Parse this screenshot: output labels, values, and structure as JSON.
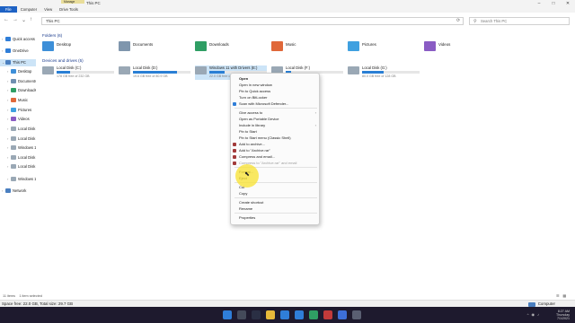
{
  "window": {
    "title": "This PC",
    "manage_tab": "Manage",
    "ribbon_tabs": [
      "File",
      "Computer",
      "View",
      "Drive Tools"
    ],
    "controls": [
      "–",
      "□",
      "✕"
    ]
  },
  "address": {
    "path": "This PC",
    "search_placeholder": "Search This PC"
  },
  "nav": {
    "items": [
      {
        "label": "Quick access",
        "color": "#2f7ed8",
        "chev": "›"
      },
      {
        "label": "OneDrive",
        "color": "#2f7ed8",
        "chev": "›"
      },
      {
        "label": "This PC",
        "color": "#4a7fc0",
        "chev": "⌄"
      },
      {
        "label": "Desktop",
        "color": "#3d8fd8",
        "chev": "›"
      },
      {
        "label": "Documents",
        "color": "#6f8fb0",
        "chev": "›"
      },
      {
        "label": "Downloads",
        "color": "#2f9e64",
        "chev": "›"
      },
      {
        "label": "Music",
        "color": "#e0683a",
        "chev": "›"
      },
      {
        "label": "Pictures",
        "color": "#3fa0e0",
        "chev": "›"
      },
      {
        "label": "Videos",
        "color": "#8a5cc4",
        "chev": "›"
      },
      {
        "label": "Local Disk (",
        "color": "#9aa8b5",
        "chev": "›"
      },
      {
        "label": "Local Disk (",
        "color": "#9aa8b5",
        "chev": "›"
      },
      {
        "label": "Windows 1",
        "color": "#9aa8b5",
        "chev": "›"
      },
      {
        "label": "Local Disk (",
        "color": "#9aa8b5",
        "chev": "›"
      },
      {
        "label": "Local Disk (",
        "color": "#9aa8b5",
        "chev": "›"
      },
      {
        "label": "Windows 1",
        "color": "#9aa8b5",
        "chev": "›"
      },
      {
        "label": "Network",
        "color": "#4a7fc0",
        "chev": "›"
      }
    ]
  },
  "folders_header": "Folders (6)",
  "folders": [
    {
      "label": "Desktop",
      "color": "#3d8fd8"
    },
    {
      "label": "Documents",
      "color": "#7f96ad"
    },
    {
      "label": "Downloads",
      "color": "#2f9e64"
    },
    {
      "label": "Music",
      "color": "#e0683a"
    },
    {
      "label": "Pictures",
      "color": "#3fa0e0"
    },
    {
      "label": "Videos",
      "color": "#8a5cc4"
    }
  ],
  "drives_header": "Devices and drives (5)",
  "drives": [
    {
      "name": "Local Disk (C:)",
      "info": "178 GB free of 232 GB",
      "used_fraction": 0.23
    },
    {
      "name": "Local Disk (D:)",
      "info": "19.6 GB free of 80.9 GB",
      "used_fraction": 0.76
    },
    {
      "name": "Windows 11 with Drivers (E:)",
      "info": "22.0 GB free of 29.7 GB",
      "used_fraction": 0.26
    },
    {
      "name": "Local Disk (F:)",
      "info": "",
      "used_fraction": 0.1
    },
    {
      "name": "Local Disk (G:)",
      "info": "80.0 GB free of 128 GB",
      "used_fraction": 0.38
    }
  ],
  "context_menu": [
    {
      "label": "Open",
      "bold": true
    },
    {
      "label": "Open in new window"
    },
    {
      "label": "Pin to Quick access"
    },
    {
      "label": "Turn on BitLocker"
    },
    {
      "label": "Scan with Microsoft Defender...",
      "icon": "#2f7ed8"
    },
    {
      "sep": true
    },
    {
      "label": "Give access to",
      "arrow": "›"
    },
    {
      "label": "Open as Portable Device"
    },
    {
      "label": "Include in library",
      "arrow": "›"
    },
    {
      "label": "Pin to Start"
    },
    {
      "label": "Pin to Start menu (Classic Shell)"
    },
    {
      "label": "Add to archive...",
      "icon": "#a23a3a"
    },
    {
      "label": "Add to \"Archive.rar\"",
      "icon": "#a23a3a"
    },
    {
      "label": "Compress and email...",
      "icon": "#a23a3a"
    },
    {
      "label": "Compress to \"Archive.rar\" and email",
      "icon": "#a23a3a",
      "dim": true
    },
    {
      "sep": true
    },
    {
      "label": "Format..."
    },
    {
      "label": "Eject"
    },
    {
      "sep": true
    },
    {
      "label": "Cut"
    },
    {
      "label": "Copy"
    },
    {
      "sep": true
    },
    {
      "label": "Create shortcut"
    },
    {
      "label": "Rename"
    },
    {
      "sep": true
    },
    {
      "label": "Properties"
    }
  ],
  "status": {
    "items": "11 items",
    "selected": "1 item selected"
  },
  "info": {
    "text": "Space free: 22.0 GB, Total size: 29.7 GB",
    "computer": "Computer"
  },
  "taskbar": {
    "icons": [
      "#2f7ed8",
      "#444a5a",
      "#2a2f44",
      "#e8b93a",
      "#2f7ed8",
      "#2f7ed8",
      "#2f9e64",
      "#c23a3a",
      "#3d6fd8",
      "#5a5f72"
    ],
    "time": "8:27 AM",
    "day": "Thursday",
    "date": "7/1/2021"
  }
}
